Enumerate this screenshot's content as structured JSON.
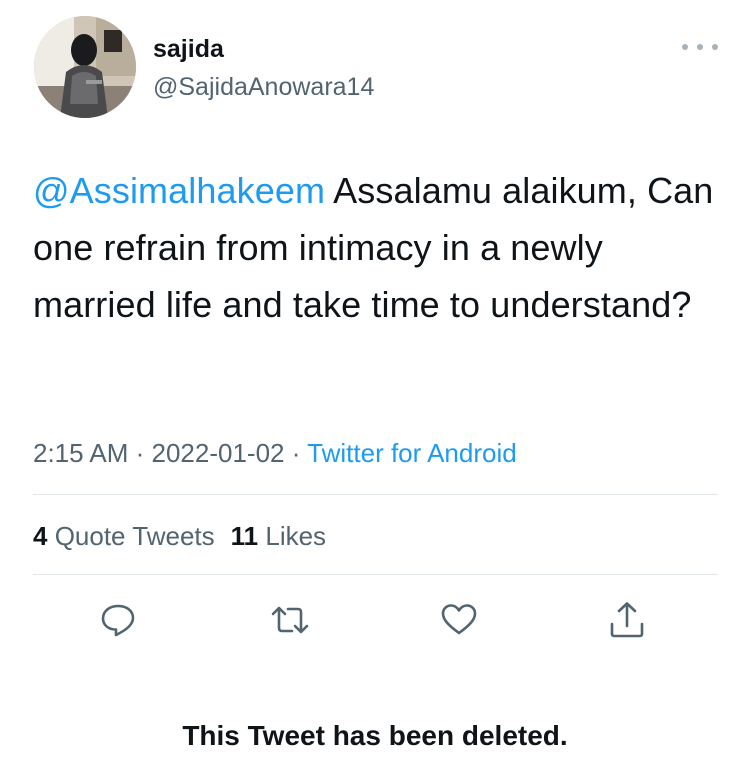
{
  "author": {
    "display_name": "sajida",
    "handle": "@SajidaAnowara14",
    "avatar": "profile-photo-avatar"
  },
  "tweet": {
    "mention": "@Assimalhakeem",
    "text": " Assalamu alaikum, Can one refrain from intimacy in a newly married life and take time to understand?"
  },
  "meta": {
    "time": "2:15 AM",
    "separator": " · ",
    "date": "2022-01-02",
    "source": "Twitter for Android"
  },
  "stats": {
    "quote_count": "4",
    "quote_label": " Quote Tweets",
    "like_count": "11",
    "like_label": " Likes"
  },
  "actions": {
    "reply_icon": "speech-bubble-icon",
    "retweet_icon": "retweet-arrows-icon",
    "like_icon": "heart-icon",
    "share_icon": "share-upload-icon"
  },
  "notice": "This Tweet has been deleted.",
  "colors": {
    "link": "#1d9bf0",
    "secondary_text": "#536471",
    "primary_text": "#0f1419",
    "divider": "#e1e6ea"
  }
}
